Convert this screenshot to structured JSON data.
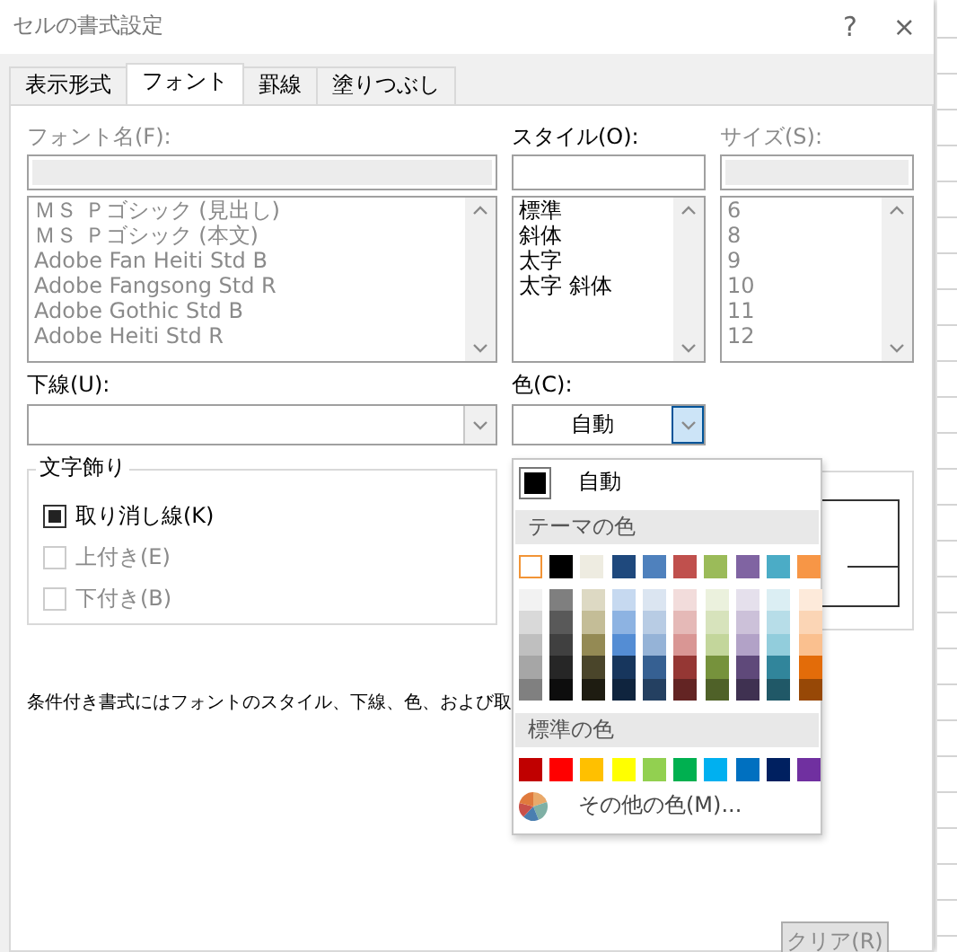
{
  "window": {
    "title": "セルの書式設定",
    "help": "?",
    "close": "×"
  },
  "tabs": [
    {
      "label": "表示形式",
      "selected": false
    },
    {
      "label": "フォント",
      "selected": true
    },
    {
      "label": "罫線",
      "selected": false
    },
    {
      "label": "塗りつぶし",
      "selected": false
    }
  ],
  "font_name": {
    "label": "フォント名(F):",
    "disabled": true,
    "items": [
      "ＭＳ Ｐゴシック (見出し)",
      "ＭＳ Ｐゴシック (本文)",
      "Adobe Fan Heiti Std B",
      "Adobe Fangsong Std R",
      "Adobe Gothic Std B",
      "Adobe Heiti Std R"
    ]
  },
  "font_style": {
    "label": "スタイル(O):",
    "disabled": false,
    "items": [
      "標準",
      "斜体",
      "太字",
      "太字 斜体"
    ]
  },
  "font_size": {
    "label": "サイズ(S):",
    "disabled": true,
    "items": [
      "6",
      "8",
      "9",
      "10",
      "11",
      "12"
    ]
  },
  "underline": {
    "label": "下線(U):"
  },
  "color": {
    "label": "色(C):",
    "value": "自動",
    "expanded": true
  },
  "effects": {
    "title": "文字飾り",
    "options": [
      {
        "label": "取り消し線(K)",
        "checked": true,
        "disabled": false
      },
      {
        "label": "上付き(E)",
        "checked": false,
        "disabled": true
      },
      {
        "label": "下付き(B)",
        "checked": false,
        "disabled": true
      }
    ]
  },
  "note": "条件付き書式にはフォントのスタイル、下線、色、および取",
  "clear_button": {
    "label": "クリア(R)",
    "disabled": true
  },
  "color_menu": {
    "automatic": {
      "label": "自動",
      "color": "#000000"
    },
    "theme_heading": "テーマの色",
    "theme_colors": [
      {
        "color": "#ffffff",
        "selected": true,
        "shades": [
          {
            "color": "#f2f2f2"
          },
          {
            "color": "#d9d9d9"
          },
          {
            "color": "#bfbfbf"
          },
          {
            "color": "#a6a6a6"
          },
          {
            "color": "#808080"
          }
        ]
      },
      {
        "color": "#000000",
        "selected": false,
        "shades": [
          {
            "color": "#7f7f7f"
          },
          {
            "color": "#595959"
          },
          {
            "color": "#404040"
          },
          {
            "color": "#262626"
          },
          {
            "color": "#0d0d0d"
          }
        ]
      },
      {
        "color": "#eeece1",
        "selected": false,
        "shades": [
          {
            "color": "#ddd9c3"
          },
          {
            "color": "#c4bd97"
          },
          {
            "color": "#948a54"
          },
          {
            "color": "#4a452a"
          },
          {
            "color": "#1e1c11"
          }
        ]
      },
      {
        "color": "#1f497d",
        "selected": false,
        "shades": [
          {
            "color": "#c6d9f0"
          },
          {
            "color": "#8db3e2"
          },
          {
            "color": "#548dd4"
          },
          {
            "color": "#17365d"
          },
          {
            "color": "#0f243e"
          }
        ]
      },
      {
        "color": "#4f81bd",
        "selected": false,
        "shades": [
          {
            "color": "#dbe5f1"
          },
          {
            "color": "#b8cce4"
          },
          {
            "color": "#95b3d7"
          },
          {
            "color": "#366092"
          },
          {
            "color": "#244061"
          }
        ]
      },
      {
        "color": "#c0504d",
        "selected": false,
        "shades": [
          {
            "color": "#f2dcdb"
          },
          {
            "color": "#e5b9b7"
          },
          {
            "color": "#d99694"
          },
          {
            "color": "#953734"
          },
          {
            "color": "#632423"
          }
        ]
      },
      {
        "color": "#9bbb59",
        "selected": false,
        "shades": [
          {
            "color": "#ebf1dd"
          },
          {
            "color": "#d7e3bc"
          },
          {
            "color": "#c3d69b"
          },
          {
            "color": "#76923c"
          },
          {
            "color": "#4f6128"
          }
        ]
      },
      {
        "color": "#8064a2",
        "selected": false,
        "shades": [
          {
            "color": "#e5e0ec"
          },
          {
            "color": "#ccc1d9"
          },
          {
            "color": "#b2a2c7"
          },
          {
            "color": "#5f497a"
          },
          {
            "color": "#3f3151"
          }
        ]
      },
      {
        "color": "#4bacc6",
        "selected": false,
        "shades": [
          {
            "color": "#dbeef3"
          },
          {
            "color": "#b7dde8"
          },
          {
            "color": "#92cddc"
          },
          {
            "color": "#31859b"
          },
          {
            "color": "#205867"
          }
        ]
      },
      {
        "color": "#f79646",
        "selected": false,
        "shades": [
          {
            "color": "#fdeada"
          },
          {
            "color": "#fbd5b5"
          },
          {
            "color": "#fac08f"
          },
          {
            "color": "#e36c09"
          },
          {
            "color": "#974806"
          }
        ]
      }
    ],
    "standard_heading": "標準の色",
    "standard_colors": [
      {
        "color": "#c00000"
      },
      {
        "color": "#ff0000"
      },
      {
        "color": "#ffc000"
      },
      {
        "color": "#ffff00"
      },
      {
        "color": "#92d050"
      },
      {
        "color": "#00b050"
      },
      {
        "color": "#00b0f0"
      },
      {
        "color": "#0070c0"
      },
      {
        "color": "#002060"
      },
      {
        "color": "#7030a0"
      }
    ],
    "more_colors": "その他の色(M)..."
  }
}
